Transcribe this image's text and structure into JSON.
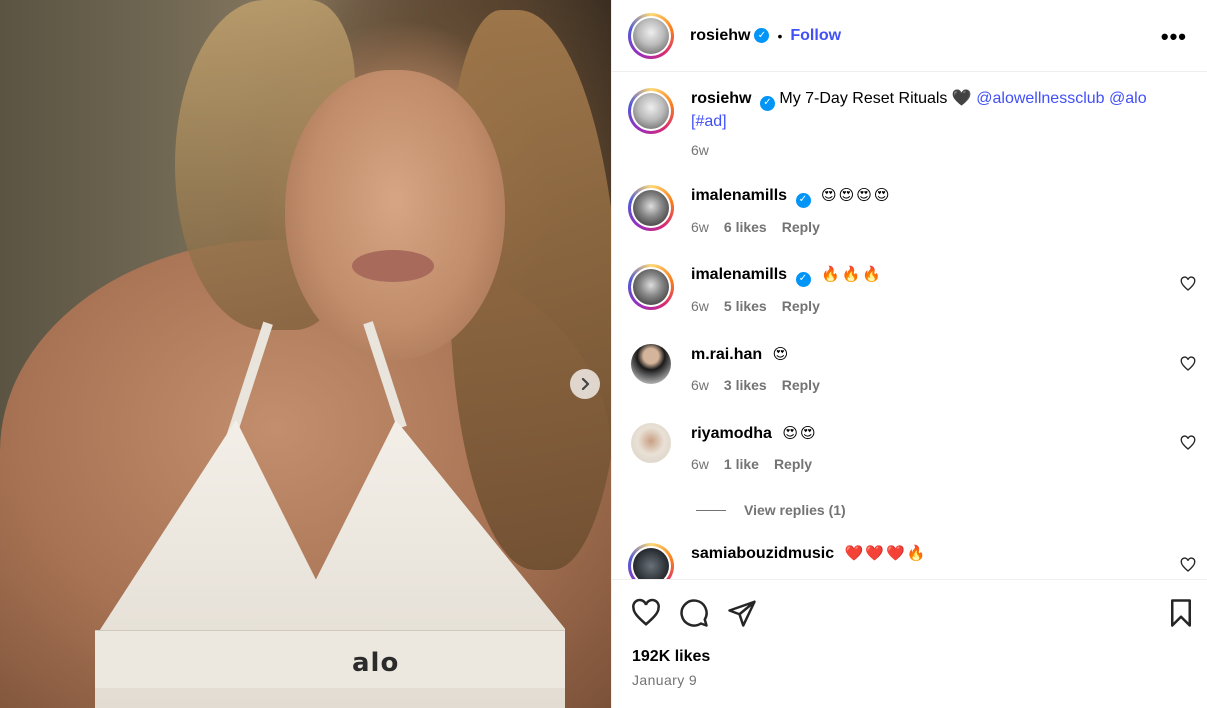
{
  "post": {
    "image_alt": "alo",
    "author": "rosiehw",
    "follow_label": "Follow",
    "more_label": "•••",
    "caption": {
      "username": "rosiehw",
      "text": "My 7-Day Reset Rituals 🖤",
      "mention1": "@alowellnessclub",
      "mention2": "@alo",
      "tag_open": "[",
      "tag": "#ad",
      "tag_close": "]",
      "time": "6w"
    },
    "comments": [
      {
        "username": "imalenamills",
        "verified": true,
        "text": "😍😍😍😍",
        "time": "6w",
        "likes": "6 likes",
        "reply": "Reply"
      },
      {
        "username": "imalenamills",
        "verified": true,
        "text": "🔥🔥🔥",
        "time": "6w",
        "likes": "5 likes",
        "reply": "Reply"
      },
      {
        "username": "m.rai.han",
        "verified": false,
        "text": "😍",
        "time": "6w",
        "likes": "3 likes",
        "reply": "Reply"
      },
      {
        "username": "riyamodha",
        "verified": false,
        "text": "😍😍",
        "time": "6w",
        "likes": "1 like",
        "reply": "Reply"
      },
      {
        "username": "samiabouzidmusic",
        "verified": false,
        "text": "❤️❤️❤️🔥"
      }
    ],
    "view_replies": "View replies (1)",
    "likes_count": "192K likes",
    "date": "January 9"
  },
  "icons": {
    "verified": "verified-badge-icon",
    "heart": "heart-icon",
    "comment": "comment-icon",
    "share": "share-icon",
    "save": "bookmark-icon",
    "next": "chevron-right-icon"
  },
  "colors": {
    "link": "#4150f7",
    "verified": "#0095f6",
    "muted": "#737373"
  }
}
